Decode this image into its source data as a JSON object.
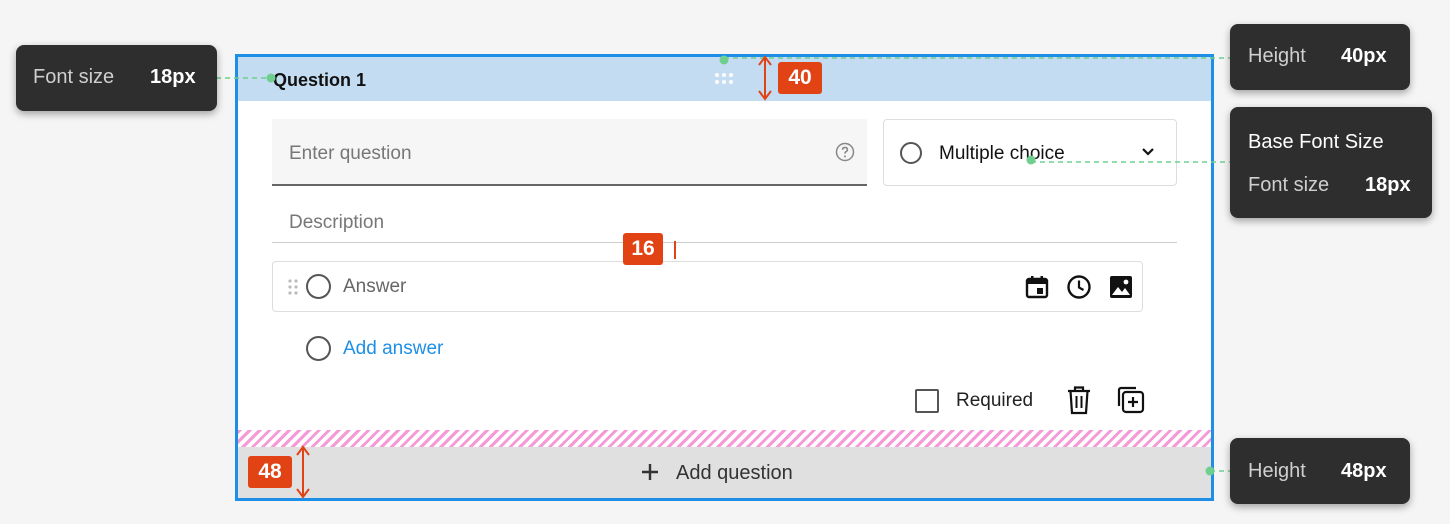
{
  "card": {
    "question_title": "Question 1",
    "question_placeholder": "Enter question",
    "type_label": "Multiple choice",
    "description_placeholder": "Description",
    "answer_placeholder": "Answer",
    "add_answer_label": "Add answer",
    "required_label": "Required",
    "add_question_label": "Add question"
  },
  "annotations": {
    "left_tip": {
      "key": "Font size",
      "value": "18px"
    },
    "header_height_tip": {
      "key": "Height",
      "value": "40px"
    },
    "base_font_tip": {
      "title": "Base Font Size",
      "key": "Font size",
      "value": "18px"
    },
    "footer_height_tip": {
      "key": "Height",
      "value": "48px"
    },
    "header_badge": "40",
    "spacing_badge": "16",
    "footer_badge": "48"
  },
  "colors": {
    "accent": "#1e8fe6",
    "header_bg": "#c4dcf2",
    "badge": "#e24315",
    "hatch_pink": "#f59ad6",
    "guide_green": "#6fcf8f"
  },
  "icons": [
    "drag-dots-icon",
    "help-circle-icon",
    "chevron-down-icon",
    "grip-icon",
    "calendar-icon",
    "clock-icon",
    "image-icon",
    "trash-icon",
    "copy-add-icon",
    "plus-icon"
  ]
}
